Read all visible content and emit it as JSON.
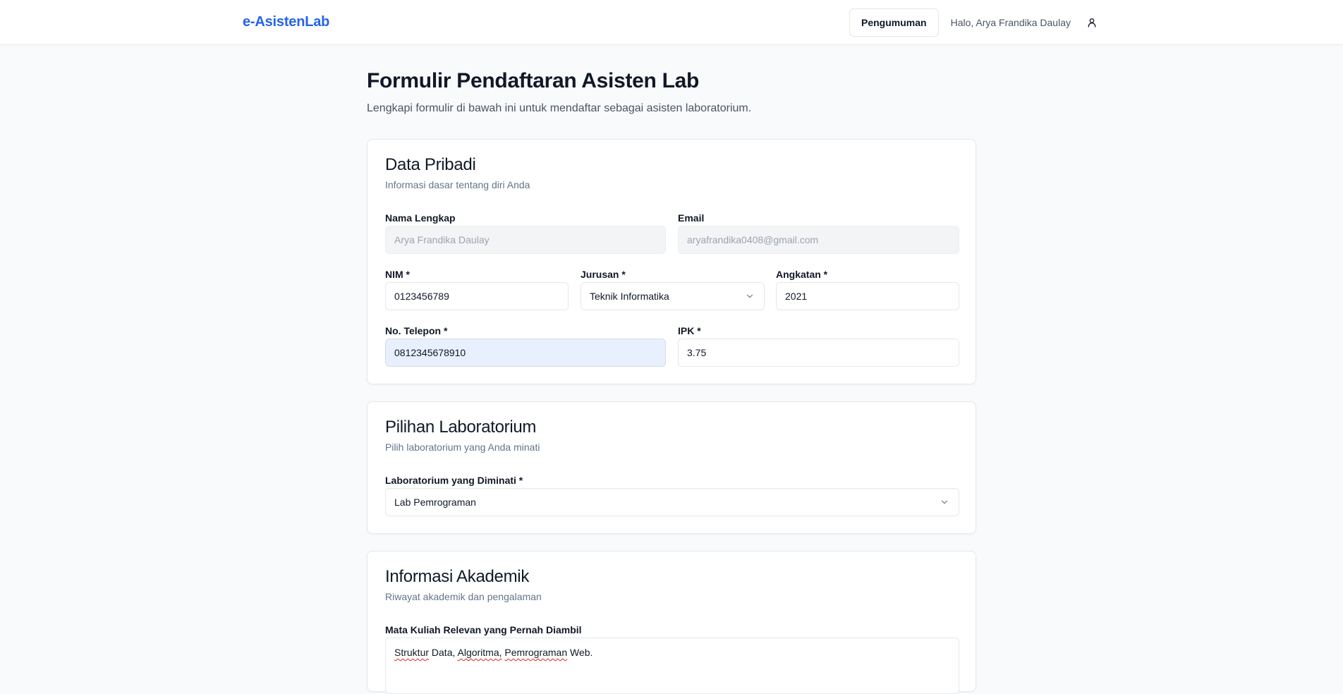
{
  "nav": {
    "brand": "e-AsistenLab",
    "announcement_button": "Pengumuman",
    "greeting": "Halo, Arya Frandika Daulay",
    "user_icon": "user-icon"
  },
  "page": {
    "title": "Formulir Pendaftaran Asisten Lab",
    "subtitle": "Lengkapi formulir di bawah ini untuk mendaftar sebagai asisten laboratorium."
  },
  "personal": {
    "title": "Data Pribadi",
    "description": "Informasi dasar tentang diri Anda",
    "full_name": {
      "label": "Nama Lengkap",
      "value": "Arya Frandika Daulay"
    },
    "email": {
      "label": "Email",
      "value": "aryafrandika0408@gmail.com"
    },
    "nim": {
      "label": "NIM *",
      "value": "0123456789"
    },
    "major": {
      "label": "Jurusan *",
      "value": "Teknik Informatika"
    },
    "year": {
      "label": "Angkatan *",
      "value": "2021"
    },
    "phone": {
      "label": "No. Telepon *",
      "value": "0812345678910"
    },
    "gpa": {
      "label": "IPK *",
      "value": "3.75"
    }
  },
  "lab": {
    "title": "Pilihan Laboratorium",
    "description": "Pilih laboratorium yang Anda minati",
    "preferred": {
      "label": "Laboratorium yang Diminati *",
      "value": "Lab Pemrograman"
    }
  },
  "academic": {
    "title": "Informasi Akademik",
    "description": "Riwayat akademik dan pengalaman",
    "courses": {
      "label": "Mata Kuliah Relevan yang Pernah Diambil",
      "words": [
        "Struktur",
        "Data,",
        "Algoritma,",
        "Pemrograman",
        "Web."
      ]
    }
  },
  "colors": {
    "brand": "#2563eb",
    "autofill": "#e8f0fe"
  }
}
